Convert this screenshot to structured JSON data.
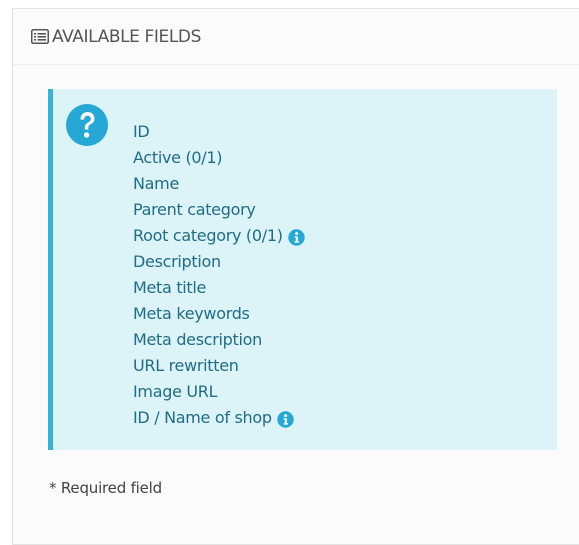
{
  "panel": {
    "title": "AVAILABLE FIELDS",
    "title_icon": "list-icon"
  },
  "alert": {
    "icon": "question-circle-icon",
    "fields": [
      {
        "label": "ID",
        "info": false
      },
      {
        "label": "Active (0/1)",
        "info": false
      },
      {
        "label": "Name",
        "info": false
      },
      {
        "label": "Parent category",
        "info": false
      },
      {
        "label": "Root category (0/1)",
        "info": true
      },
      {
        "label": "Description",
        "info": false
      },
      {
        "label": "Meta title",
        "info": false
      },
      {
        "label": "Meta keywords",
        "info": false
      },
      {
        "label": "Meta description",
        "info": false
      },
      {
        "label": "URL rewritten",
        "info": false
      },
      {
        "label": "Image URL",
        "info": false
      },
      {
        "label": "ID / Name of shop",
        "info": true
      }
    ]
  },
  "footer": {
    "required_note": "* Required field"
  },
  "colors": {
    "alert_background": "#dcf3f8",
    "alert_border": "#2fb6d7",
    "field_text": "#1f6d86",
    "icon_blue": "#25a8d6"
  }
}
